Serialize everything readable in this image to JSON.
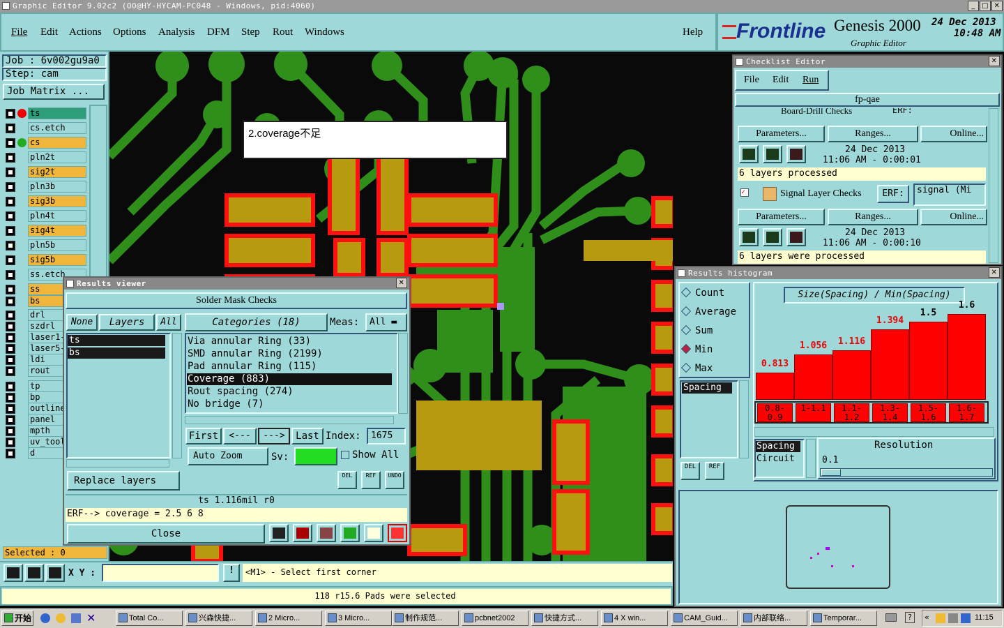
{
  "app": {
    "title": "Graphic Editor 9.02c2 (OO@HY-HYCAM-PC048 - Windows, pid:4060)",
    "brand": "Frontline",
    "product": "Genesis 2000",
    "subtitle": "Graphic Editor",
    "date": "24 Dec 2013",
    "time": "10:48 AM"
  },
  "menu": [
    "File",
    "Edit",
    "Actions",
    "Options",
    "Analysis",
    "DFM",
    "Step",
    "Rout",
    "Windows"
  ],
  "help": "Help",
  "job": {
    "job": "Job  :  6v002gu9a0",
    "step": "Step: cam",
    "matrix": "Job Matrix ..."
  },
  "layers": [
    "ts",
    "cs.etch",
    "cs",
    "pln2t",
    "sig2t",
    "pln3b",
    "sig3b",
    "pln4t",
    "sig4t",
    "pln5b",
    "sig5b",
    "ss.etch",
    "ss",
    "bs",
    "drl",
    "szdrl",
    "laser1-",
    "laser5-",
    "ldi",
    "rout",
    "tp",
    "bp",
    "outline",
    "panel",
    "mpth",
    "uv_tool",
    "d"
  ],
  "selected": "Selected : 0",
  "xy_label": "X Y :",
  "prompt": "<M1> - Select first corner",
  "status": "118 r15.6 Pads were selected",
  "note": "2.coverage不足",
  "checklist": {
    "title": "Checklist Editor",
    "menu": [
      "File",
      "Edit",
      "Run"
    ],
    "name": "fp-qae",
    "c1_title": "Board-Drill Checks",
    "c1_erf": "ERF:",
    "params": "Parameters...",
    "ranges": "Ranges...",
    "online": "Online...",
    "c1_date": "24 Dec 2013",
    "c1_time": "11:06 AM - 0:00:01",
    "c1_status": "6 layers processed",
    "c2_title": "Signal Layer Checks",
    "c2_erf": "ERF:",
    "c2_erfval": "signal (Mi",
    "c2_date": "24 Dec 2013",
    "c2_time": "11:06 AM - 0:00:10",
    "c2_status": "6 layers were processed"
  },
  "results": {
    "title": "Results viewer",
    "header": "Solder Mask Checks",
    "none": "None",
    "layers": "Layers",
    "all": "All",
    "categories": "Categories (18)",
    "meas": "Meas:",
    "meas_val": "All",
    "layer_items": [
      "ts",
      "bs"
    ],
    "cats": [
      "Via annular Ring (33)",
      "SMD annular Ring (2199)",
      "Pad annular Ring (115)",
      "Coverage (883)",
      "Rout spacing (274)",
      "No bridge (7)"
    ],
    "first": "First",
    "prev": "<---",
    "next": "--->",
    "last": "Last",
    "index_label": "Index:",
    "index_val": "1675",
    "auto_zoom": "Auto Zoom",
    "sv": "Sv:",
    "show_all": "Show All",
    "replace": "Replace layers",
    "del": "DEL",
    "ref": "REF",
    "undo": "UNDO",
    "measure": "ts 1.116mil  r0",
    "erf": "ERF--> coverage = 2.5 6 8",
    "close": "Close"
  },
  "histogram": {
    "title": "Results histogram",
    "options": [
      "Count",
      "Average",
      "Sum",
      "Min",
      "Max"
    ],
    "selected_option": "Min",
    "list1": [
      "Spacing"
    ],
    "list2": [
      "Spacing",
      "Circuit"
    ],
    "chart_title": "Size(Spacing) / Min(Spacing)",
    "resolution": "Resolution",
    "res_val": "0.1",
    "del": "DEL",
    "ref": "REF"
  },
  "chart_data": {
    "type": "bar",
    "title": "Size(Spacing) / Min(Spacing)",
    "categories": [
      "0.8-0.9",
      "1-1.1",
      "1.1-1.2",
      "1.3-1.4",
      "1.5-1.6",
      "1.6-1.7"
    ],
    "values": [
      0.813,
      1.056,
      1.116,
      1.394,
      1.5,
      1.6
    ],
    "ylim": [
      0,
      1.8
    ],
    "color": "#ff0000"
  },
  "taskbar": {
    "start": "开始",
    "items": [
      "Total Co...",
      "兴森快捷...",
      "2 Micro...",
      "3 Micro...",
      "制作规范...",
      "pcbnet2002",
      "快捷方式...",
      "4 X win...",
      "CAM_Guid...",
      "内部联络...",
      "Temporar..."
    ],
    "clock": "11:15"
  }
}
